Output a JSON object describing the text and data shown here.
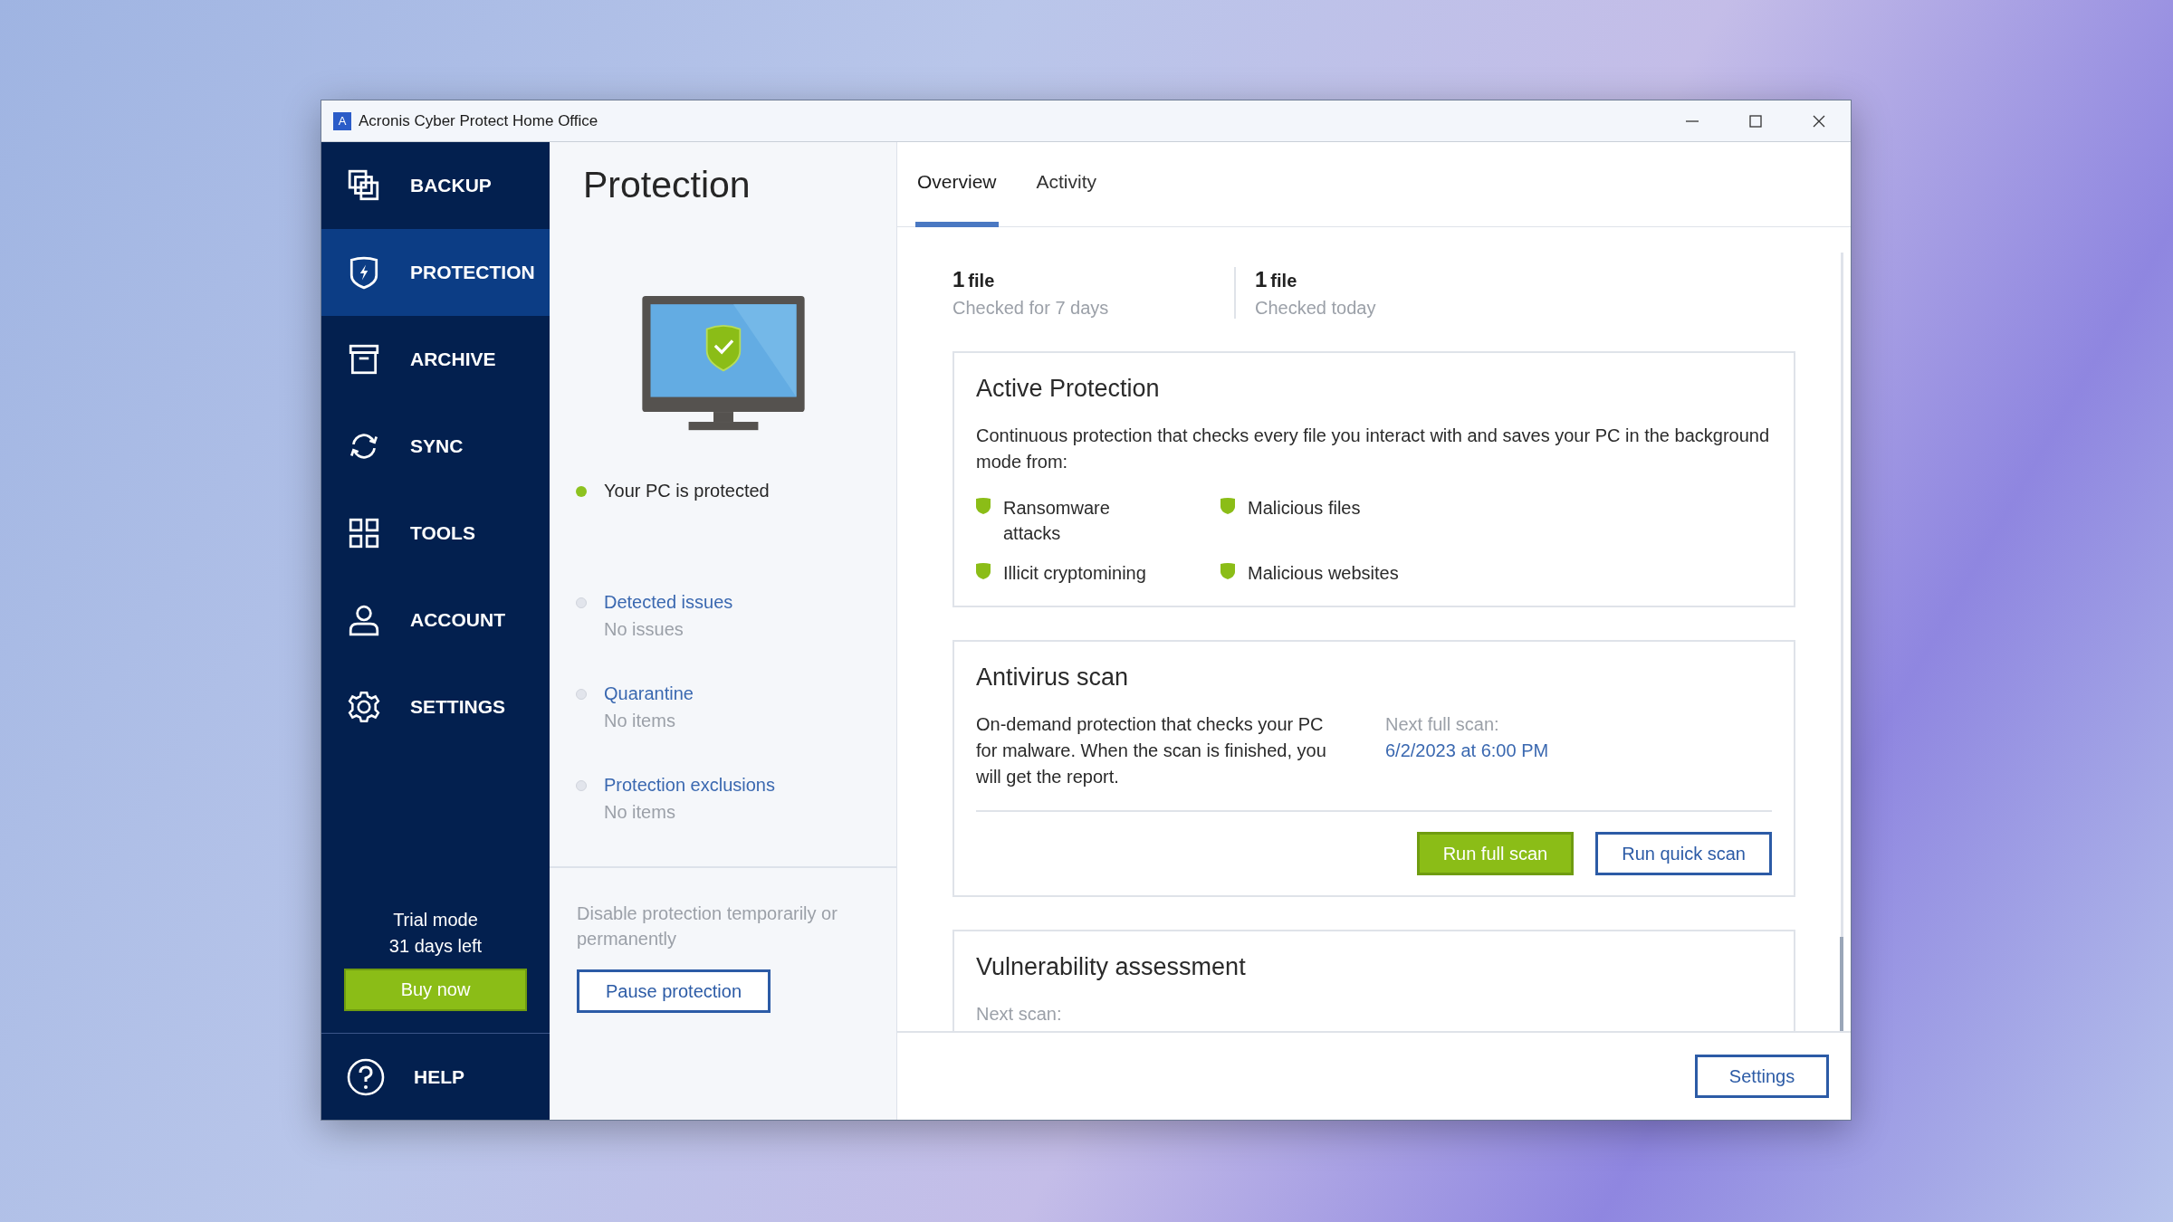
{
  "window": {
    "logo_letter": "A",
    "title": "Acronis Cyber Protect Home Office"
  },
  "sidebar": {
    "items": [
      {
        "label": "BACKUP",
        "kind": "backup",
        "selected": false
      },
      {
        "label": "PROTECTION",
        "kind": "protection",
        "selected": true
      },
      {
        "label": "ARCHIVE",
        "kind": "archive",
        "selected": false
      },
      {
        "label": "SYNC",
        "kind": "sync",
        "selected": false
      },
      {
        "label": "TOOLS",
        "kind": "tools",
        "selected": false
      },
      {
        "label": "ACCOUNT",
        "kind": "account",
        "selected": false
      },
      {
        "label": "SETTINGS",
        "kind": "settings",
        "selected": false
      }
    ],
    "trial": [
      "Trial mode",
      "31 days left"
    ],
    "buy_button": "Buy now",
    "help": "HELP"
  },
  "protection_panel": {
    "title": "Protection",
    "items": [
      {
        "kind": "status",
        "title": "Your PC is protected",
        "color": "#8dc21f"
      },
      {
        "kind": "link",
        "title": "Detected issues",
        "detail": "No issues",
        "color": "#e2e5ec"
      },
      {
        "kind": "link",
        "title": "Quarantine",
        "detail": "No items",
        "color": "#e2e5ec"
      },
      {
        "kind": "link",
        "title": "Protection exclusions",
        "detail": "No items",
        "color": "#e2e5ec"
      }
    ],
    "disable_note": "Disable protection temporarily or permanently",
    "pause_button": "Pause protection"
  },
  "tabs": [
    {
      "label": "Overview",
      "selected": true
    },
    {
      "label": "Activity",
      "selected": false
    }
  ],
  "stats": [
    {
      "count": "1",
      "unit": "file",
      "caption": "Checked for 7 days"
    },
    {
      "count": "1",
      "unit": "file",
      "caption": "Checked today"
    }
  ],
  "active_protection": {
    "title": "Active Protection",
    "description": "Continuous protection that checks every file you interact with and saves your PC in the background mode from:",
    "threats": [
      "Ransomware attacks",
      "Illicit cryptomining",
      "Malicious files",
      "Malicious websites"
    ]
  },
  "antivirus_scan": {
    "title": "Antivirus scan",
    "description": "On-demand protection that checks your PC for malware. When the scan is finished, you will get the report.",
    "next_label": "Next full scan:",
    "next_value": "6/2/2023 at 6:00 PM",
    "buttons": [
      {
        "label": "Run full scan",
        "kind": "primary"
      },
      {
        "label": "Run quick scan",
        "kind": "outline"
      }
    ]
  },
  "vulnerability_assessment": {
    "title": "Vulnerability assessment",
    "next_label": "Next scan:"
  },
  "footer": {
    "settings_button": "Settings"
  }
}
